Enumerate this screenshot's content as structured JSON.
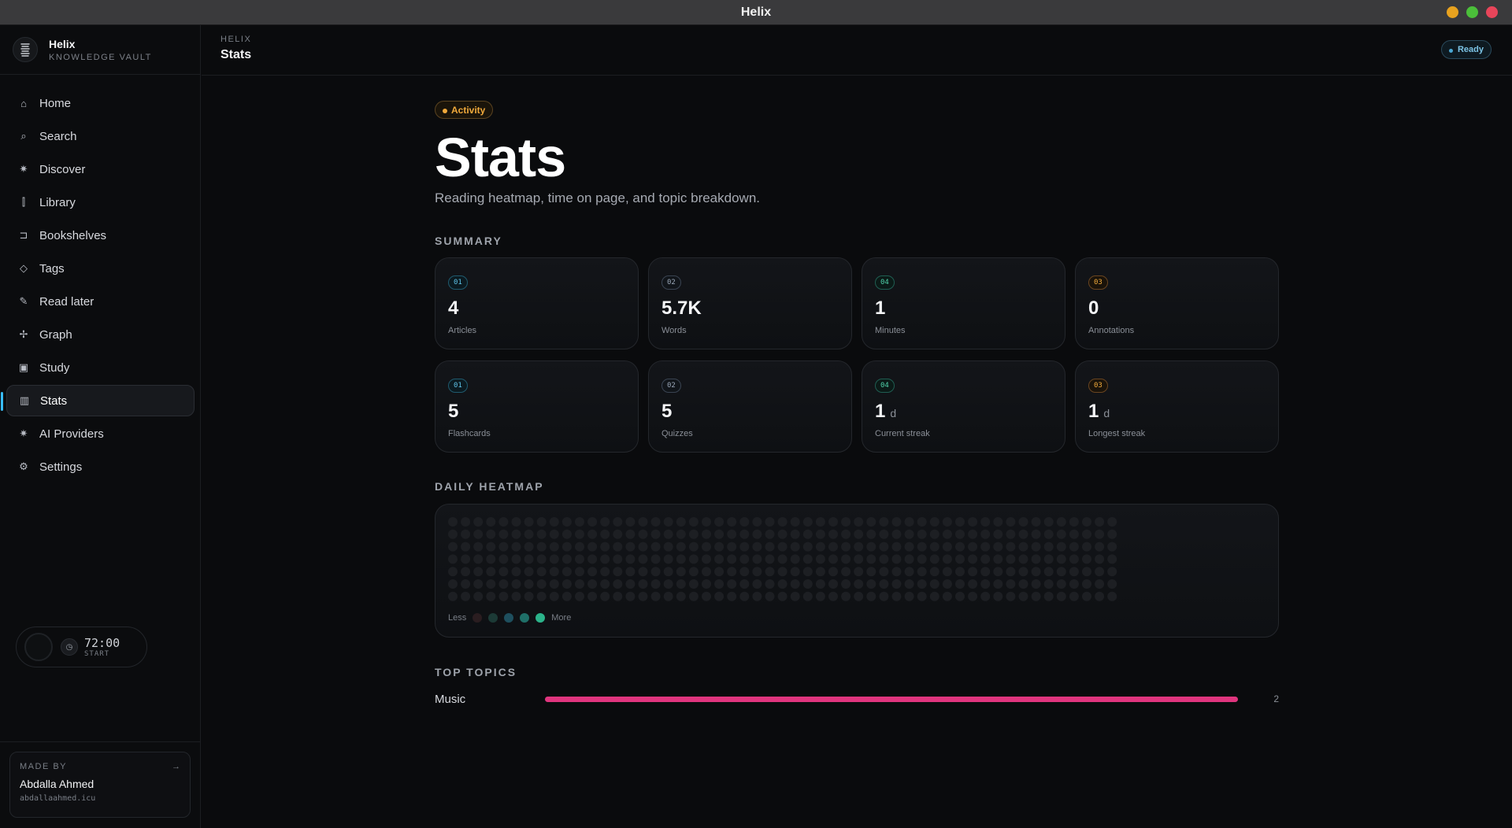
{
  "window": {
    "title": "Helix",
    "buttons": [
      {
        "name": "minimize",
        "color": "#e8a21f"
      },
      {
        "name": "maximize",
        "color": "#4bbf3a"
      },
      {
        "name": "close",
        "color": "#e8455a"
      }
    ]
  },
  "brand": {
    "name": "Helix",
    "subtitle": "KNOWLEDGE VAULT"
  },
  "sidebar": {
    "items": [
      {
        "label": "Home",
        "icon": "home-icon",
        "glyph": "⌂",
        "active": false
      },
      {
        "label": "Search",
        "icon": "search-icon",
        "glyph": "⌕",
        "active": false
      },
      {
        "label": "Discover",
        "icon": "sparkle-icon",
        "glyph": "✷",
        "active": false
      },
      {
        "label": "Library",
        "icon": "library-icon",
        "glyph": "⫿",
        "active": false
      },
      {
        "label": "Bookshelves",
        "icon": "bookmark-icon",
        "glyph": "⊐",
        "active": false
      },
      {
        "label": "Tags",
        "icon": "tag-icon",
        "glyph": "◇",
        "active": false
      },
      {
        "label": "Read later",
        "icon": "pin-icon",
        "glyph": "✎",
        "active": false
      },
      {
        "label": "Graph",
        "icon": "graph-icon",
        "glyph": "✢",
        "active": false
      },
      {
        "label": "Study",
        "icon": "cards-icon",
        "glyph": "▣",
        "active": false
      },
      {
        "label": "Stats",
        "icon": "bar-chart-icon",
        "glyph": "▥",
        "active": true
      },
      {
        "label": "AI Providers",
        "icon": "sparkle-icon",
        "glyph": "✷",
        "active": false
      },
      {
        "label": "Settings",
        "icon": "gear-icon",
        "glyph": "⚙",
        "active": false
      }
    ],
    "timer": {
      "time": "72:00",
      "label": "START"
    },
    "credit": {
      "label": "MADE BY",
      "name": "Abdalla Ahmed",
      "url": "abdallaahmed.icu"
    }
  },
  "header": {
    "breadcrumb": "HELIX",
    "title": "Stats",
    "status": "Ready"
  },
  "page": {
    "badge": "Activity",
    "title": "Stats",
    "description": "Reading heatmap, time on page, and topic breakdown."
  },
  "summary": {
    "label": "SUMMARY",
    "cards": [
      {
        "chip": "01",
        "chip_style": "c1",
        "value": "4",
        "unit": "",
        "label": "Articles"
      },
      {
        "chip": "02",
        "chip_style": "c2",
        "value": "5.7K",
        "unit": "",
        "label": "Words"
      },
      {
        "chip": "04",
        "chip_style": "c3",
        "value": "1",
        "unit": "",
        "label": "Minutes"
      },
      {
        "chip": "03",
        "chip_style": "c4",
        "value": "0",
        "unit": "",
        "label": "Annotations"
      },
      {
        "chip": "01",
        "chip_style": "c1",
        "value": "5",
        "unit": "",
        "label": "Flashcards"
      },
      {
        "chip": "02",
        "chip_style": "c2",
        "value": "5",
        "unit": "",
        "label": "Quizzes"
      },
      {
        "chip": "04",
        "chip_style": "c3",
        "value": "1",
        "unit": "d",
        "label": "Current streak"
      },
      {
        "chip": "03",
        "chip_style": "c4",
        "value": "1",
        "unit": "d",
        "label": "Longest streak"
      }
    ]
  },
  "heatmap": {
    "label": "DAILY HEATMAP",
    "weeks": 53,
    "days": 7,
    "empty_color": "#1d1f23",
    "legend": {
      "less": "Less",
      "more": "More",
      "colors": [
        "#2a1d20",
        "#1c3a36",
        "#1e4f5e",
        "#1f6f68",
        "#2bb38a"
      ]
    }
  },
  "topics": {
    "label": "TOP TOPICS",
    "items": [
      {
        "name": "Music",
        "count": "2",
        "share": 1.0,
        "color": "#e0357e"
      }
    ]
  }
}
